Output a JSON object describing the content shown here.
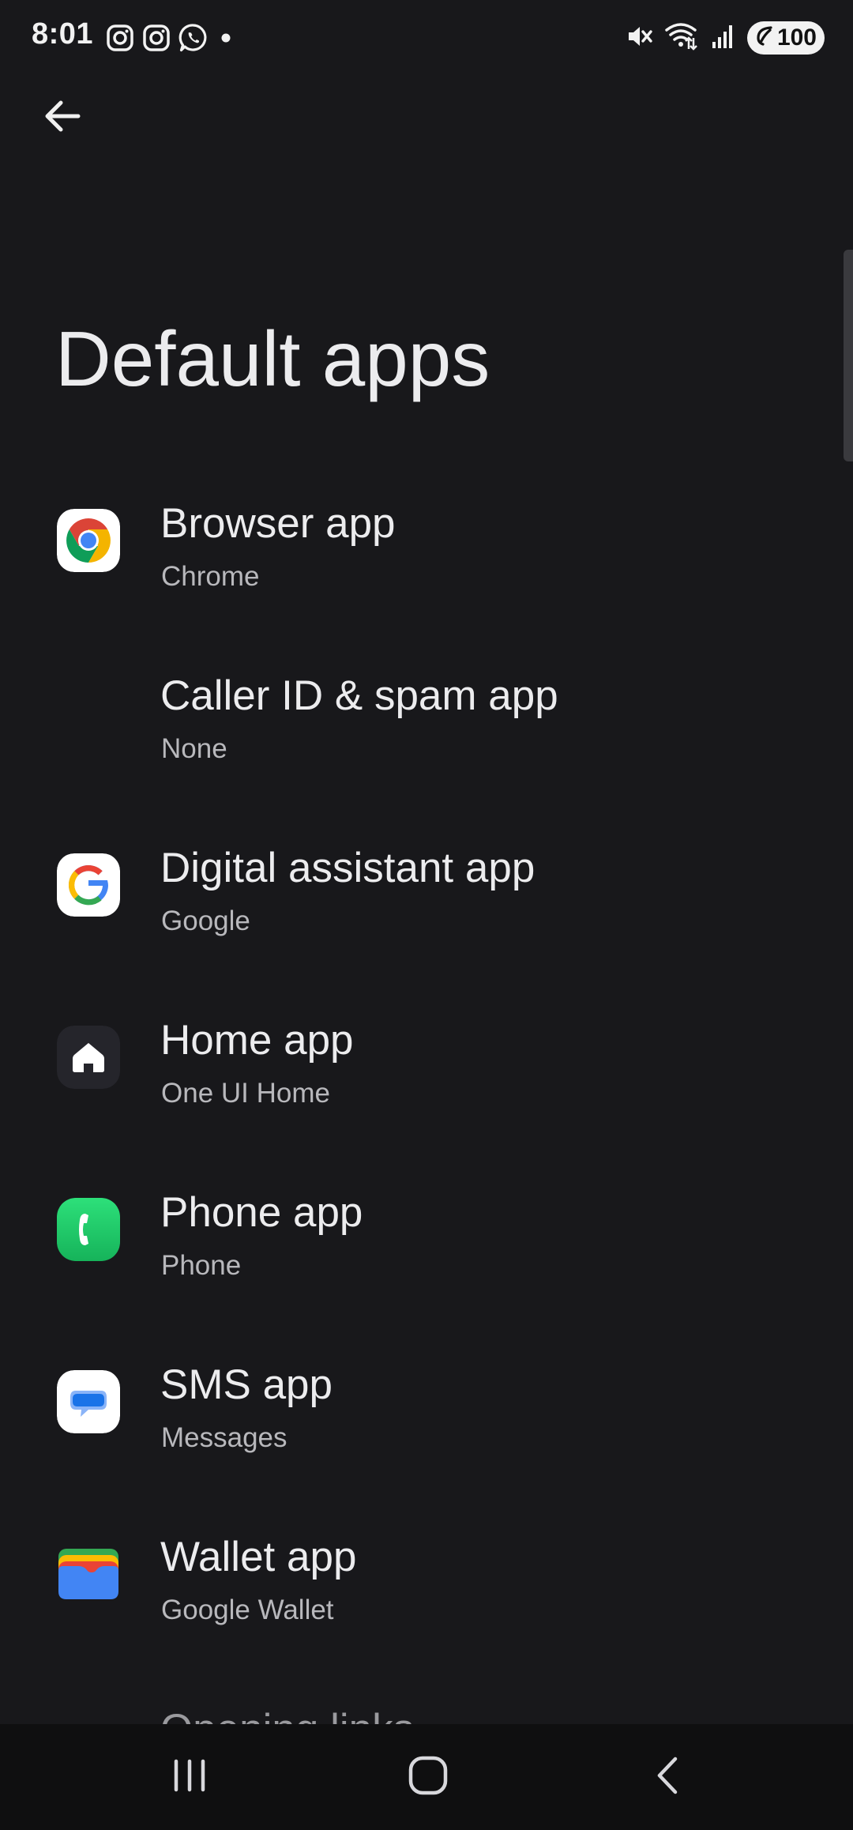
{
  "status_bar": {
    "time": "8:01",
    "left_icons": [
      "instagram-icon",
      "instagram-icon",
      "whatsapp-icon",
      "dot-icon"
    ],
    "right_icons": [
      "mute-icon",
      "wifi-icon",
      "signal-icon"
    ],
    "battery": "100"
  },
  "header": {
    "back_icon": "arrow-left-icon",
    "title": "Default apps"
  },
  "items": [
    {
      "title": "Browser app",
      "subtitle": "Chrome",
      "icon": "chrome-icon"
    },
    {
      "title": "Caller ID & spam app",
      "subtitle": "None",
      "icon": ""
    },
    {
      "title": "Digital assistant app",
      "subtitle": "Google",
      "icon": "google-icon"
    },
    {
      "title": "Home app",
      "subtitle": "One UI Home",
      "icon": "home-icon"
    },
    {
      "title": "Phone app",
      "subtitle": "Phone",
      "icon": "phone-icon"
    },
    {
      "title": "SMS app",
      "subtitle": "Messages",
      "icon": "messages-icon"
    },
    {
      "title": "Wallet app",
      "subtitle": "Google Wallet",
      "icon": "wallet-icon"
    }
  ],
  "partial_item": {
    "title": "Opening links"
  },
  "nav_bar": {
    "icons": [
      "recents-icon",
      "home-nav-icon",
      "back-nav-icon"
    ]
  },
  "colors": {
    "background": "#18181b",
    "text_primary": "#ececee",
    "text_secondary": "#b8b8bc",
    "nav_background": "#0f0f10"
  }
}
